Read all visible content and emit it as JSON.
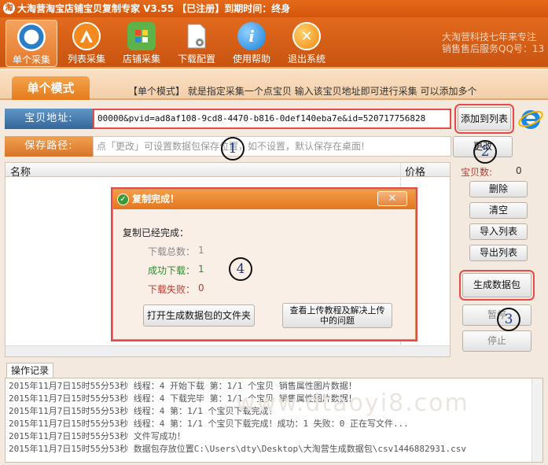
{
  "window": {
    "title": "大淘营淘宝店铺宝贝复制专家 V3.55 【已注册】到期时间：终身"
  },
  "toolbar": {
    "items": [
      {
        "label": "单个采集",
        "icon": "single-collect-icon"
      },
      {
        "label": "列表采集",
        "icon": "list-collect-icon"
      },
      {
        "label": "店铺采集",
        "icon": "shop-collect-icon"
      },
      {
        "label": "下载配置",
        "icon": "download-config-icon"
      },
      {
        "label": "使用帮助",
        "icon": "help-icon"
      },
      {
        "label": "退出系统",
        "icon": "exit-icon"
      }
    ],
    "info_line1": "大淘营科技七年来专注",
    "info_line2": "销售售后服务QQ号：13"
  },
  "mode": {
    "tab": "单个模式",
    "description": "【单个模式】 就是指定采集一个点宝贝  输入该宝贝地址即可进行采集  可以添加多个"
  },
  "url_row": {
    "label": "宝贝地址:",
    "value": "00000&pvid=ad8af108-9cd8-4470-b816-0def140eba7e&id=520717756828",
    "add_button": "添加到列表"
  },
  "path_row": {
    "label": "保存路径:",
    "placeholder": "点「更改」可设置数据包保存位置，如不设置，默认保存在桌面!",
    "change_button": "更改"
  },
  "table": {
    "headers": [
      "名称",
      "价格"
    ]
  },
  "side": {
    "count_label": "宝贝数:",
    "count_value": "0",
    "buttons": [
      "删除",
      "清空",
      "导入列表",
      "导出列表"
    ],
    "generate": "生成数据包",
    "pause": "暂停",
    "stop": "停止"
  },
  "log": {
    "tab": "操作记录",
    "lines": [
      "2015年11月7日15时55分53秒 线程：4  开始下载 第：1/1  个宝贝   销售属性图片数据！",
      "2015年11月7日15时55分53秒 线程：4  下载完毕 第：1/1  个宝贝   销售属性图片数据！",
      "2015年11月7日15时55分53秒 线程：4 第：1/1 个宝贝下载完成！",
      "2015年11月7日15时55分53秒  线程：4 第：1/1 个宝贝下载完成！成功：1 失败：0 正在写文件...",
      "2015年11月7日15时55分53秒 文件写成功！",
      "2015年11月7日15时55分53秒 数据包存放位置C:\\Users\\dty\\Desktop\\大淘营生成数据包\\csv1446882931.csv"
    ]
  },
  "dialog": {
    "title": "复制完成！",
    "heading": "复制已经完成：",
    "total_label": "下载总数：",
    "total_value": "1",
    "success_label": "成功下载：",
    "success_value": "1",
    "fail_label": "下载失败：",
    "fail_value": "0",
    "open_folder": "打开生成数据包的文件夹",
    "help_line1": "查看上传教程及解决上传",
    "help_line2": "中的问题"
  },
  "annotations": [
    "1",
    "2",
    "3",
    "4"
  ],
  "watermark": "www.dtaoyi8.com",
  "colors": {
    "accent": "#e37721",
    "highlight": "#e84a4a",
    "label_blue": "#33679b",
    "success": "#2e8b2e",
    "fail": "#c0392b"
  }
}
